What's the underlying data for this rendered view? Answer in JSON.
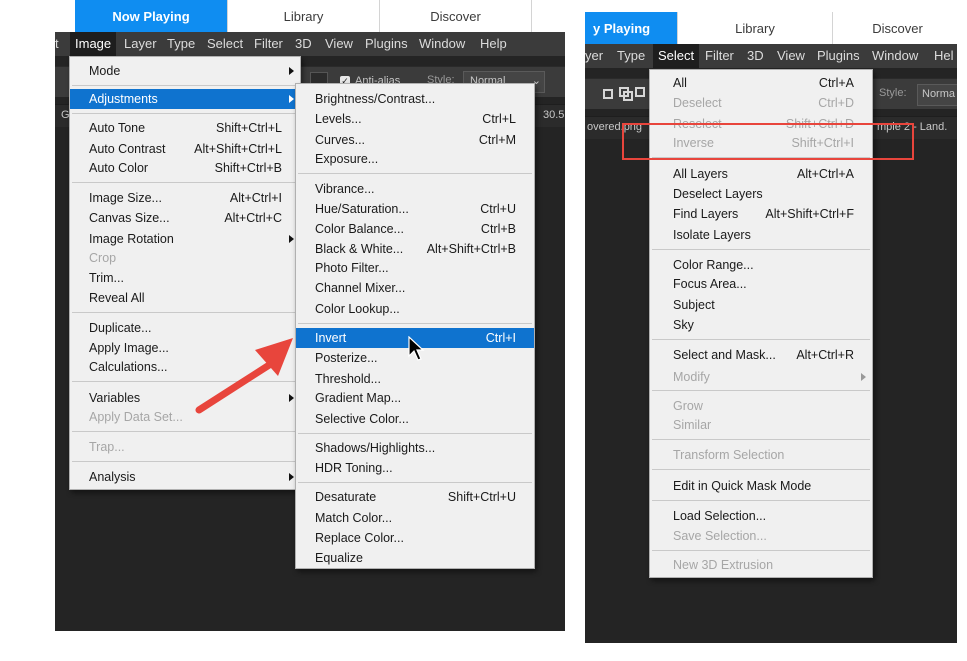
{
  "left": {
    "tabs": [
      "Now Playing",
      "Library",
      "Discover"
    ],
    "menubar": [
      "t",
      "Image",
      "Layer",
      "Type",
      "Select",
      "Filter",
      "3D",
      "View",
      "Plugins",
      "Window",
      "Help"
    ],
    "options": {
      "antialias": "Anti-alias",
      "style_label": "Style:",
      "style_value": "Normal"
    },
    "doc_left": "G",
    "doc_right": "30.5",
    "image_menu": [
      {
        "label": "Mode",
        "shortcut": "",
        "submenu": true
      },
      {
        "label": "Adjustments",
        "shortcut": "",
        "submenu": true
      },
      {
        "label": "Auto Tone",
        "shortcut": "Shift+Ctrl+L"
      },
      {
        "label": "Auto Contrast",
        "shortcut": "Alt+Shift+Ctrl+L"
      },
      {
        "label": "Auto Color",
        "shortcut": "Shift+Ctrl+B"
      },
      {
        "label": "Image Size...",
        "shortcut": "Alt+Ctrl+I"
      },
      {
        "label": "Canvas Size...",
        "shortcut": "Alt+Ctrl+C"
      },
      {
        "label": "Image Rotation",
        "shortcut": "",
        "submenu": true
      },
      {
        "label": "Crop",
        "shortcut": ""
      },
      {
        "label": "Trim...",
        "shortcut": ""
      },
      {
        "label": "Reveal All",
        "shortcut": ""
      },
      {
        "label": "Duplicate...",
        "shortcut": ""
      },
      {
        "label": "Apply Image...",
        "shortcut": ""
      },
      {
        "label": "Calculations...",
        "shortcut": ""
      },
      {
        "label": "Variables",
        "shortcut": "",
        "submenu": true
      },
      {
        "label": "Apply Data Set...",
        "shortcut": ""
      },
      {
        "label": "Trap...",
        "shortcut": ""
      },
      {
        "label": "Analysis",
        "shortcut": "",
        "submenu": true
      }
    ],
    "adjustments_menu": [
      {
        "label": "Brightness/Contrast...",
        "shortcut": ""
      },
      {
        "label": "Levels...",
        "shortcut": "Ctrl+L"
      },
      {
        "label": "Curves...",
        "shortcut": "Ctrl+M"
      },
      {
        "label": "Exposure...",
        "shortcut": ""
      },
      {
        "label": "Vibrance...",
        "shortcut": ""
      },
      {
        "label": "Hue/Saturation...",
        "shortcut": "Ctrl+U"
      },
      {
        "label": "Color Balance...",
        "shortcut": "Ctrl+B"
      },
      {
        "label": "Black & White...",
        "shortcut": "Alt+Shift+Ctrl+B"
      },
      {
        "label": "Photo Filter...",
        "shortcut": ""
      },
      {
        "label": "Channel Mixer...",
        "shortcut": ""
      },
      {
        "label": "Color Lookup...",
        "shortcut": ""
      },
      {
        "label": "Invert",
        "shortcut": "Ctrl+I"
      },
      {
        "label": "Posterize...",
        "shortcut": ""
      },
      {
        "label": "Threshold...",
        "shortcut": ""
      },
      {
        "label": "Gradient Map...",
        "shortcut": ""
      },
      {
        "label": "Selective Color...",
        "shortcut": ""
      },
      {
        "label": "Shadows/Highlights...",
        "shortcut": ""
      },
      {
        "label": "HDR Toning...",
        "shortcut": ""
      },
      {
        "label": "Desaturate",
        "shortcut": "Shift+Ctrl+U"
      },
      {
        "label": "Match Color...",
        "shortcut": ""
      },
      {
        "label": "Replace Color...",
        "shortcut": ""
      },
      {
        "label": "Equalize",
        "shortcut": ""
      }
    ]
  },
  "right": {
    "tabs": [
      "y Playing",
      "Library",
      "Discover"
    ],
    "menubar": [
      "yer",
      "Type",
      "Select",
      "Filter",
      "3D",
      "View",
      "Plugins",
      "Window",
      "Hel"
    ],
    "options": {
      "style_label": "Style:",
      "style_value": "Norma"
    },
    "doc_left": "overed.png",
    "doc_right": "mple 2 - Land.",
    "select_menu": [
      {
        "label": "All",
        "shortcut": "Ctrl+A"
      },
      {
        "label": "Deselect",
        "shortcut": "Ctrl+D"
      },
      {
        "label": "Reselect",
        "shortcut": "Shift+Ctrl+D"
      },
      {
        "label": "Inverse",
        "shortcut": "Shift+Ctrl+I"
      },
      {
        "label": "All Layers",
        "shortcut": "Alt+Ctrl+A"
      },
      {
        "label": "Deselect Layers",
        "shortcut": ""
      },
      {
        "label": "Find Layers",
        "shortcut": "Alt+Shift+Ctrl+F"
      },
      {
        "label": "Isolate Layers",
        "shortcut": ""
      },
      {
        "label": "Color Range...",
        "shortcut": ""
      },
      {
        "label": "Focus Area...",
        "shortcut": ""
      },
      {
        "label": "Subject",
        "shortcut": ""
      },
      {
        "label": "Sky",
        "shortcut": ""
      },
      {
        "label": "Select and Mask...",
        "shortcut": "Alt+Ctrl+R"
      },
      {
        "label": "Modify",
        "shortcut": "",
        "submenu": true
      },
      {
        "label": "Grow",
        "shortcut": ""
      },
      {
        "label": "Similar",
        "shortcut": ""
      },
      {
        "label": "Transform Selection",
        "shortcut": ""
      },
      {
        "label": "Edit in Quick Mask Mode",
        "shortcut": ""
      },
      {
        "label": "Load Selection...",
        "shortcut": ""
      },
      {
        "label": "Save Selection...",
        "shortcut": ""
      },
      {
        "label": "New 3D Extrusion",
        "shortcut": ""
      }
    ]
  },
  "colors": {
    "tab_active": "#0f8df1",
    "menu_highlight": "#0f73cf",
    "annotation": "#e8453c"
  }
}
